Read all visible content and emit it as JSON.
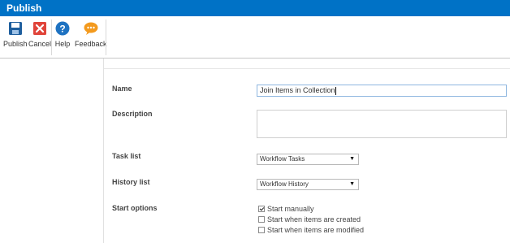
{
  "window": {
    "title": "Publish"
  },
  "ribbon": {
    "publish_label": "Publish",
    "cancel_label": "Cancel",
    "help_label": "Help",
    "feedback_label": "Feedback"
  },
  "form": {
    "name": {
      "label": "Name",
      "value": "Join Items in Collection"
    },
    "description": {
      "label": "Description",
      "value": ""
    },
    "task_list": {
      "label": "Task list",
      "selected": "Workflow Tasks"
    },
    "history_list": {
      "label": "History list",
      "selected": "Workflow History"
    },
    "start_options": {
      "label": "Start options",
      "options": [
        {
          "label": "Start manually",
          "checked": true
        },
        {
          "label": "Start when items are created",
          "checked": false
        },
        {
          "label": "Start when items are modified",
          "checked": false
        }
      ]
    }
  },
  "colors": {
    "titlebar": "#0072c6",
    "publish_icon": "#1f5f9e",
    "cancel_icon": "#e0443a",
    "help_icon": "#1e72c1",
    "feedback_icon": "#f39a1e"
  },
  "icons": [
    "save-disk-icon",
    "cancel-x-icon",
    "help-question-icon",
    "feedback-speech-icon",
    "chevron-down-icon",
    "checkmark-icon"
  ]
}
